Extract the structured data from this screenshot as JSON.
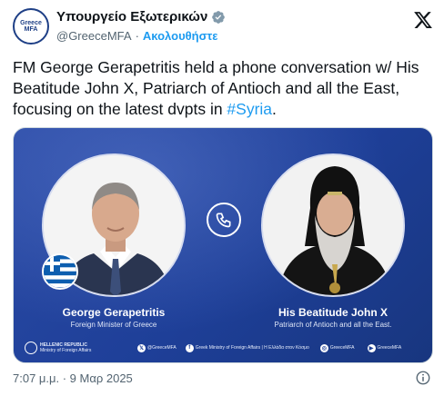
{
  "account": {
    "avatar_line1": "Greece",
    "avatar_line2": "MFA",
    "display_name": "Υπουργείο Εξωτερικών",
    "handle": "@GreeceMFA",
    "separator": "·",
    "follow_label": "Ακολουθήστε",
    "icons": {
      "verified": "verified-badge-icon",
      "platform": "x-logo-icon"
    },
    "colors": {
      "link": "#1d9bf0",
      "verified_badge": "#829aab"
    }
  },
  "tweet": {
    "text_main": "FM George Gerapetritis held a phone conversation w/ His Beatitude John X, Patriarch of Antioch and all the East, focusing on the latest dvpts in ",
    "hashtag": "#Syria",
    "text_end": "."
  },
  "media": {
    "colors": {
      "background": "#1e3f98"
    },
    "left_person": {
      "name": "George Gerapetritis",
      "role": "Foreign Minister of Greece"
    },
    "right_person": {
      "name": "His Beatitude John X",
      "role": "Patriarch of Antioch and all the East."
    },
    "footer": {
      "ministry_line1": "HELLENIC REPUBLIC",
      "ministry_line2": "Ministry of Foreign Affairs",
      "social": [
        {
          "icon": "x",
          "text": "@GreeceMFA"
        },
        {
          "icon": "f",
          "text": "Greek Ministry of Foreign Affairs | Η Ελλάδα στον Κόσμο"
        },
        {
          "icon": "ig",
          "text": "GreeceMFA"
        },
        {
          "icon": "yt",
          "text": "GreeceMFA"
        }
      ]
    }
  },
  "meta": {
    "timestamp": "7:07 μ.μ. · 9 Μαρ 2025",
    "info_icon": "info-icon"
  }
}
